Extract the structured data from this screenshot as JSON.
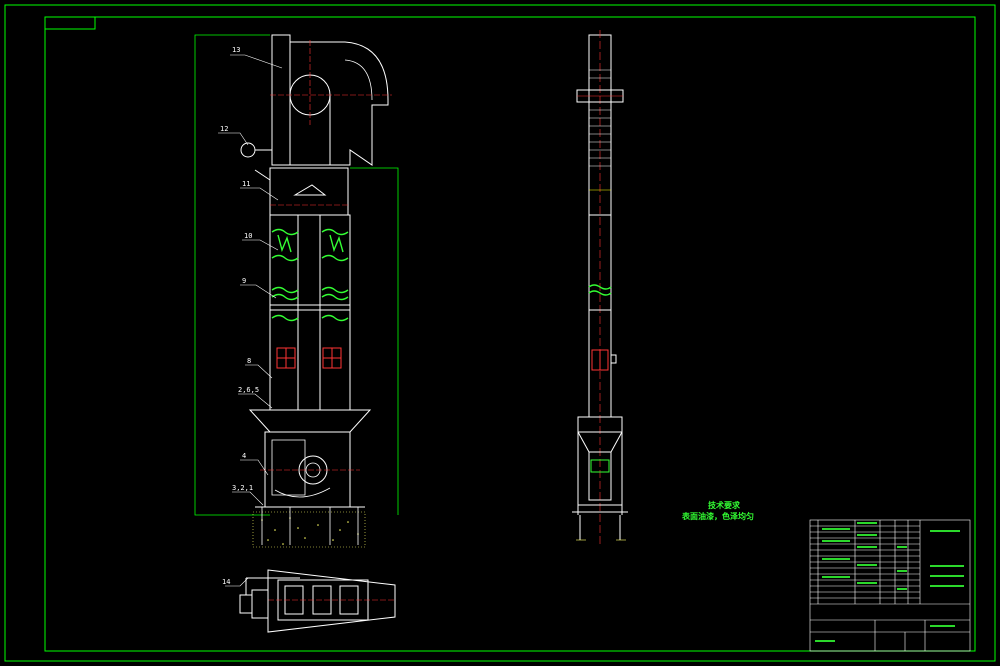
{
  "drawing": {
    "part_labels": [
      "13",
      "12",
      "11",
      "10",
      "9",
      "8",
      "2,6,5",
      "4",
      "3,2,1",
      "14"
    ],
    "tech_requirements": {
      "title": "技术要求",
      "line1": "表面油漆，色泽均匀"
    },
    "colors": {
      "background": "#000000",
      "frame": "#00ff00",
      "outline": "#ffffff",
      "centerline": "#ff0000",
      "hatch": "#33ff33",
      "accent": "#ffff00"
    }
  }
}
